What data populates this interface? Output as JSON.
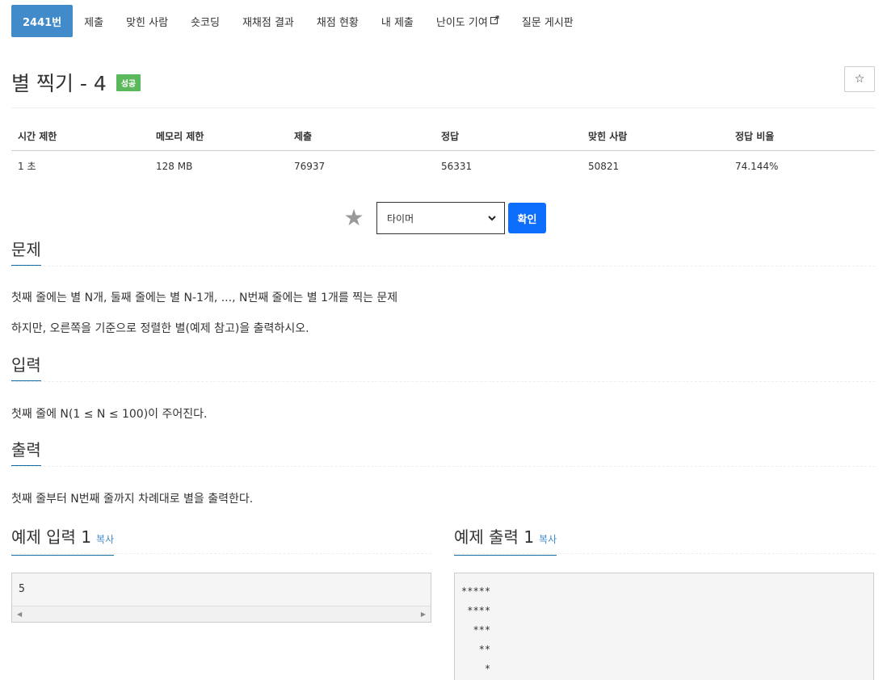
{
  "tabs": [
    {
      "label": "2441번"
    },
    {
      "label": "제출"
    },
    {
      "label": "맞힌 사람"
    },
    {
      "label": "숏코딩"
    },
    {
      "label": "재채점 결과"
    },
    {
      "label": "채점 현황"
    },
    {
      "label": "내 제출"
    },
    {
      "label": "난이도 기여"
    },
    {
      "label": "질문 게시판"
    }
  ],
  "problem": {
    "title": "별 찍기 - 4",
    "badge": "성공",
    "fav_icon": "☆"
  },
  "stats": {
    "headers": [
      "시간 제한",
      "메모리 제한",
      "제출",
      "정답",
      "맞힌 사람",
      "정답 비율"
    ],
    "values": [
      "1 초",
      "128 MB",
      "76937",
      "56331",
      "50821",
      "74.144%"
    ]
  },
  "tier": {
    "star_icon": "★",
    "selected": "타이머",
    "confirm_label": "확인"
  },
  "sections": {
    "problem_heading": "문제",
    "problem_lines": [
      "첫째 줄에는 별 N개, 둘째 줄에는 별 N-1개, ..., N번째 줄에는 별 1개를 찍는 문제",
      "하지만, 오른쪽을 기준으로 정렬한 별(예제 참고)을 출력하시오."
    ],
    "input_heading": "입력",
    "input_text": "첫째 줄에 N(1 ≤ N ≤ 100)이 주어진다.",
    "output_heading": "출력",
    "output_text": "첫째 줄부터 N번째 줄까지 차례대로 별을 출력한다."
  },
  "samples": {
    "input_heading": "예제 입력 1",
    "output_heading": "예제 출력 1",
    "copy_label": "복사",
    "input_text": "5",
    "output_text": "*****\n ****\n  ***\n   **\n    *"
  }
}
